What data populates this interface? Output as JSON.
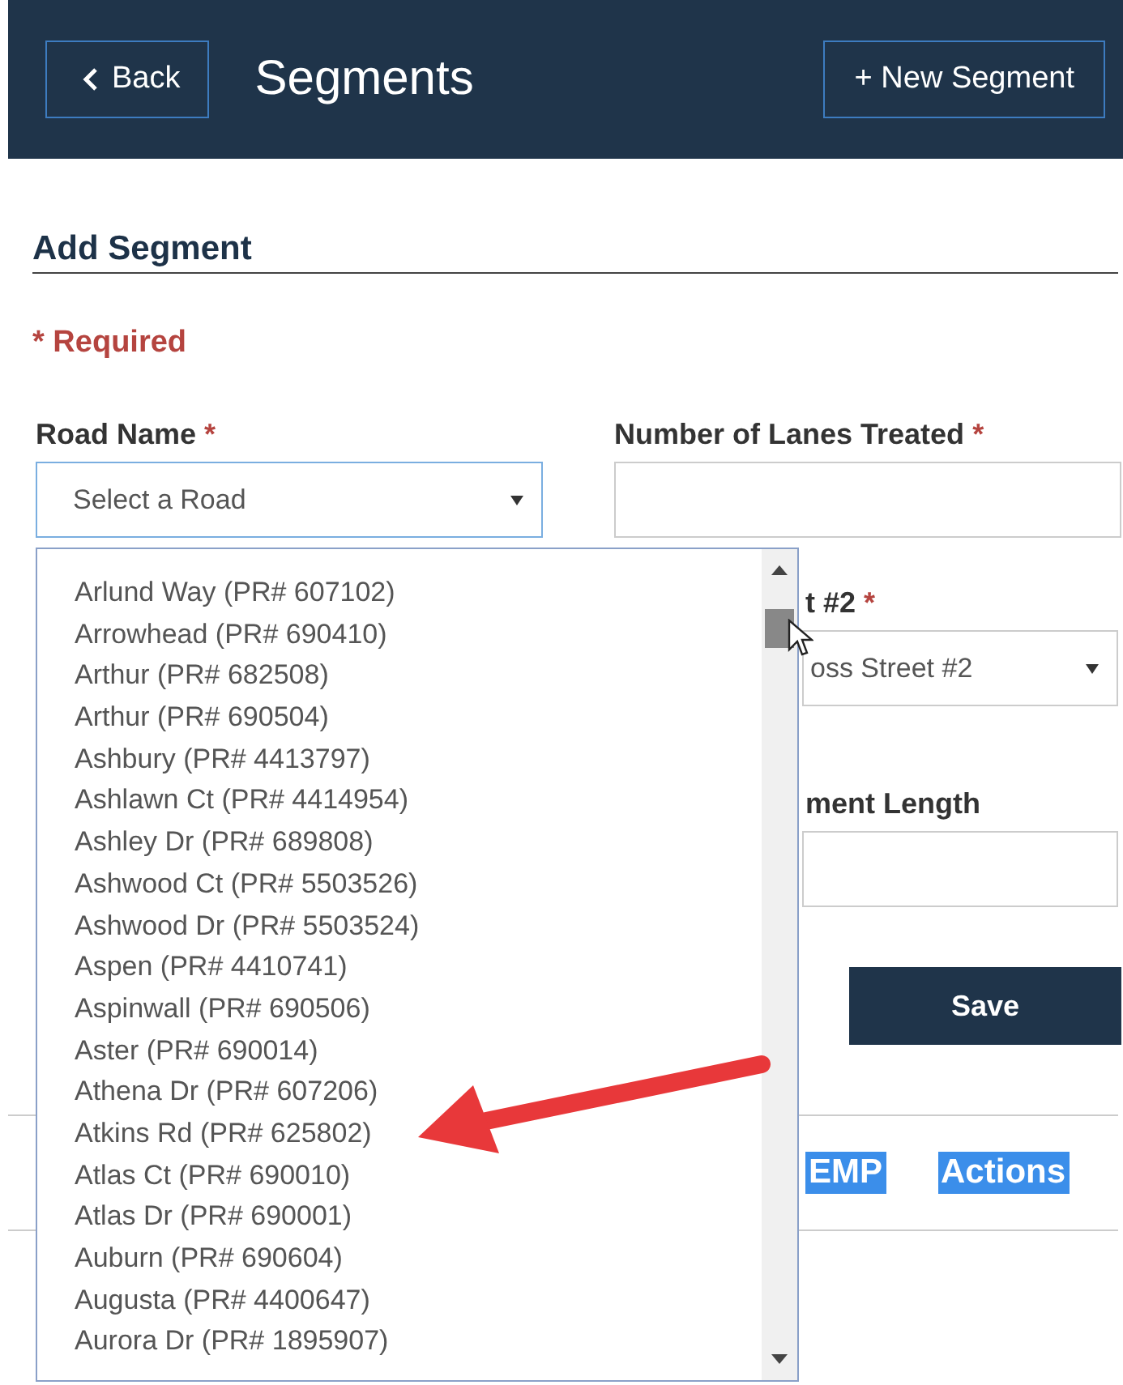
{
  "header": {
    "back_button": "Back",
    "title": "Segments",
    "new_button": "+ New Segment"
  },
  "form": {
    "heading": "Add Segment",
    "required_note": "* Required",
    "road_name": {
      "label": "Road Name",
      "required_mark": "*",
      "placeholder": "Select a Road"
    },
    "lanes": {
      "label": "Number of Lanes Treated",
      "required_mark": "*"
    },
    "cross_street_2": {
      "label": "t #2",
      "required_mark": "*",
      "placeholder": "oss Street #2"
    },
    "segment_length": {
      "label": "ment Length"
    },
    "save_button": "Save"
  },
  "road_dropdown": {
    "items": [
      "Arlund Way (PR# 607102)",
      "Arrowhead (PR# 690410)",
      "Arthur (PR# 682508)",
      "Arthur (PR# 690504)",
      "Ashbury (PR# 4413797)",
      "Ashlawn Ct (PR# 4414954)",
      "Ashley Dr (PR# 689808)",
      "Ashwood Ct (PR# 5503526)",
      "Ashwood Dr (PR# 5503524)",
      "Aspen (PR# 4410741)",
      "Aspinwall (PR# 690506)",
      "Aster (PR# 690014)",
      "Athena Dr (PR# 607206)",
      "Atkins Rd (PR# 625802)",
      "Atlas Ct (PR# 690010)",
      "Atlas Dr (PR# 690001)",
      "Auburn (PR# 690604)",
      "Augusta (PR# 4400647)",
      "Aurora Dr (PR# 1895907)"
    ]
  },
  "table": {
    "columns": [
      {
        "label": "EMP",
        "highlighted": true
      },
      {
        "label": "Actions",
        "highlighted": true
      }
    ]
  }
}
